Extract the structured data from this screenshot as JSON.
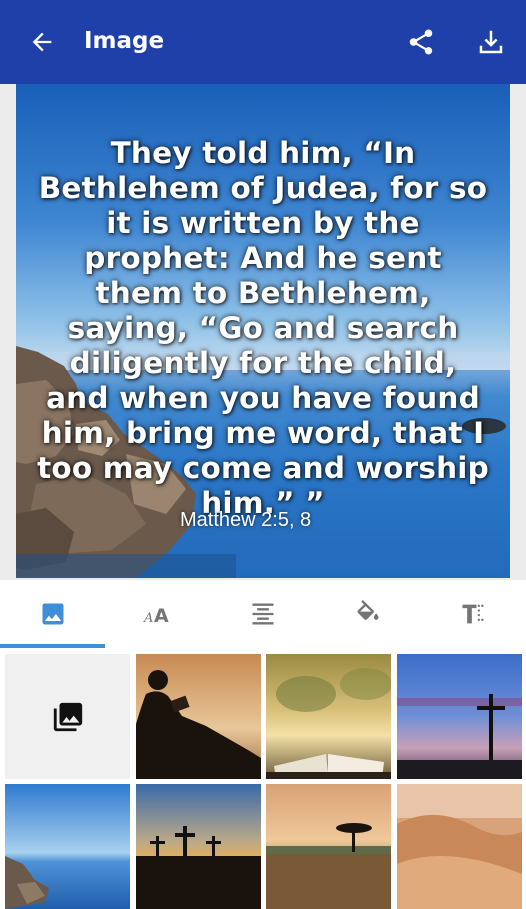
{
  "app_bar": {
    "title": "Image",
    "back_icon": "arrow-back-icon",
    "share_icon": "share-icon",
    "download_icon": "download-icon",
    "background_color": "#1e40a8"
  },
  "preview": {
    "verse_text": "They told him, “In Bethlehem of Judea, for so it is written by the prophet: And he sent them to Bethlehem, saying, “Go and search diligently for the child, and when you have found him, bring me word, that I too may come and worship him.” ”",
    "reference": "Matthew 2:5, 8",
    "text_color": "#ffffff"
  },
  "tabs": {
    "items": [
      {
        "icon": "image-icon",
        "active": true
      },
      {
        "icon": "font-size-icon",
        "active": false
      },
      {
        "icon": "align-center-icon",
        "active": false
      },
      {
        "icon": "paint-bucket-icon",
        "active": false
      },
      {
        "icon": "text-format-icon",
        "active": false
      }
    ],
    "active_color": "#3f8fd8"
  },
  "backgrounds": {
    "gallery_icon": "photo-library-icon",
    "thumbnails": [
      "person-reading-silhouette",
      "open-bible-sunset",
      "cross-twilight",
      "rocky-sea",
      "three-crosses-sunset",
      "savanna-tree-sunset",
      "desert-dunes"
    ]
  }
}
